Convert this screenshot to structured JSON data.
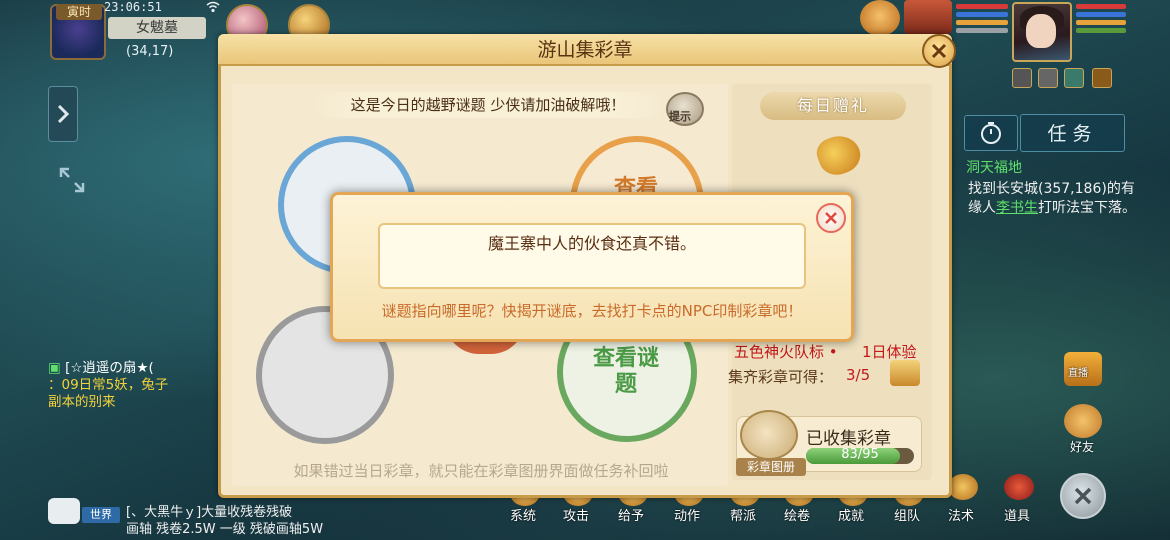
{
  "status": {
    "time_tag": "寅时",
    "clock": "23:06:51",
    "map_name": "女魃墓",
    "coords": "(34,17)"
  },
  "task_panel": {
    "task_button": "任务",
    "task_title": "洞天福地",
    "task_text_before": "找到长安城(357,186)的有缘人",
    "task_link": "李书生",
    "task_text_after": "打听法宝下落。"
  },
  "chat": {
    "line1_name": "[☆逍遥の扇★(",
    "line2": "：09日常5妖，兔子",
    "line3": "副本的别来",
    "world_tag": "世界",
    "world_line1": "[、大黑牛ｙ]大量收残卷残破",
    "world_line2": "画轴 残卷2.5W 一级 残破画轴5W"
  },
  "bottom_menu": [
    "系统",
    "攻击",
    "给予",
    "动作",
    "帮派",
    "绘卷",
    "成就",
    "组队",
    "法术",
    "道具"
  ],
  "right_widgets": {
    "live": "直播",
    "friends": "好友"
  },
  "panel": {
    "title": "游山集彩章",
    "riddle_hint": "这是今日的越野谜题 少侠请加油破解哦！",
    "hint_button": "提示",
    "view_riddle": "查看谜题",
    "view_riddle_partial": "查看",
    "footer": "如果错过当日彩章，就只能在彩章图册界面做任务补回啦",
    "daily_gift": "每日赠礼",
    "reward_name": "五色神火队标",
    "reward_dot": "•",
    "reward_duration": "1日体验",
    "collect_label": "集齐彩章可得：",
    "collect_count": "3/5",
    "album_label": "彩章图册",
    "collected_title": "已收集彩章",
    "collected_progress": "83/95",
    "collected_fraction": 0.8737
  },
  "dialog": {
    "message": "魔王寨中人的伙食还真不错。",
    "sub": "谜题指向哪里呢？快揭开谜底，去找打卡点的NPC印制彩章吧！"
  },
  "colors": {
    "panel_border": "#c89b4a",
    "reward_red": "#c2181b",
    "task_green": "#5fe06a",
    "dialog_orange": "#c96a2a"
  }
}
